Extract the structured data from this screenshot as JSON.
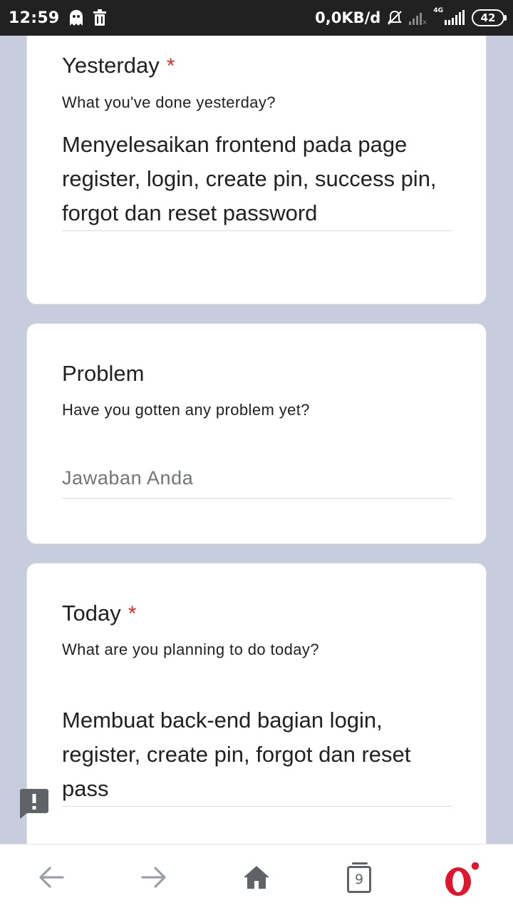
{
  "status_bar": {
    "time": "12:59",
    "data_speed": "0,0KB/d",
    "network_type": "4G",
    "battery": "42"
  },
  "questions": [
    {
      "title": "Yesterday",
      "required_marker": "*",
      "description": "What you've done yesterday?",
      "answer": "Menyelesaikan frontend pada page register, login, create pin, success pin, forgot dan reset password"
    },
    {
      "title": "Problem",
      "description": "Have you gotten any problem yet?",
      "placeholder": "Jawaban Anda"
    },
    {
      "title": "Today",
      "required_marker": "*",
      "description": "What are you planning to do today?",
      "answer": "Membuat back-end bagian login, register, create pin, forgot dan reset pass"
    }
  ],
  "bottom_nav": {
    "tab_count": "9",
    "icons": [
      "back-arrow-icon",
      "forward-arrow-icon",
      "home-icon",
      "tabs-icon",
      "opera-menu-icon"
    ]
  },
  "colors": {
    "page_background": "#c7cddd",
    "required_asterisk": "#d93025",
    "opera_red": "#e0142b"
  }
}
